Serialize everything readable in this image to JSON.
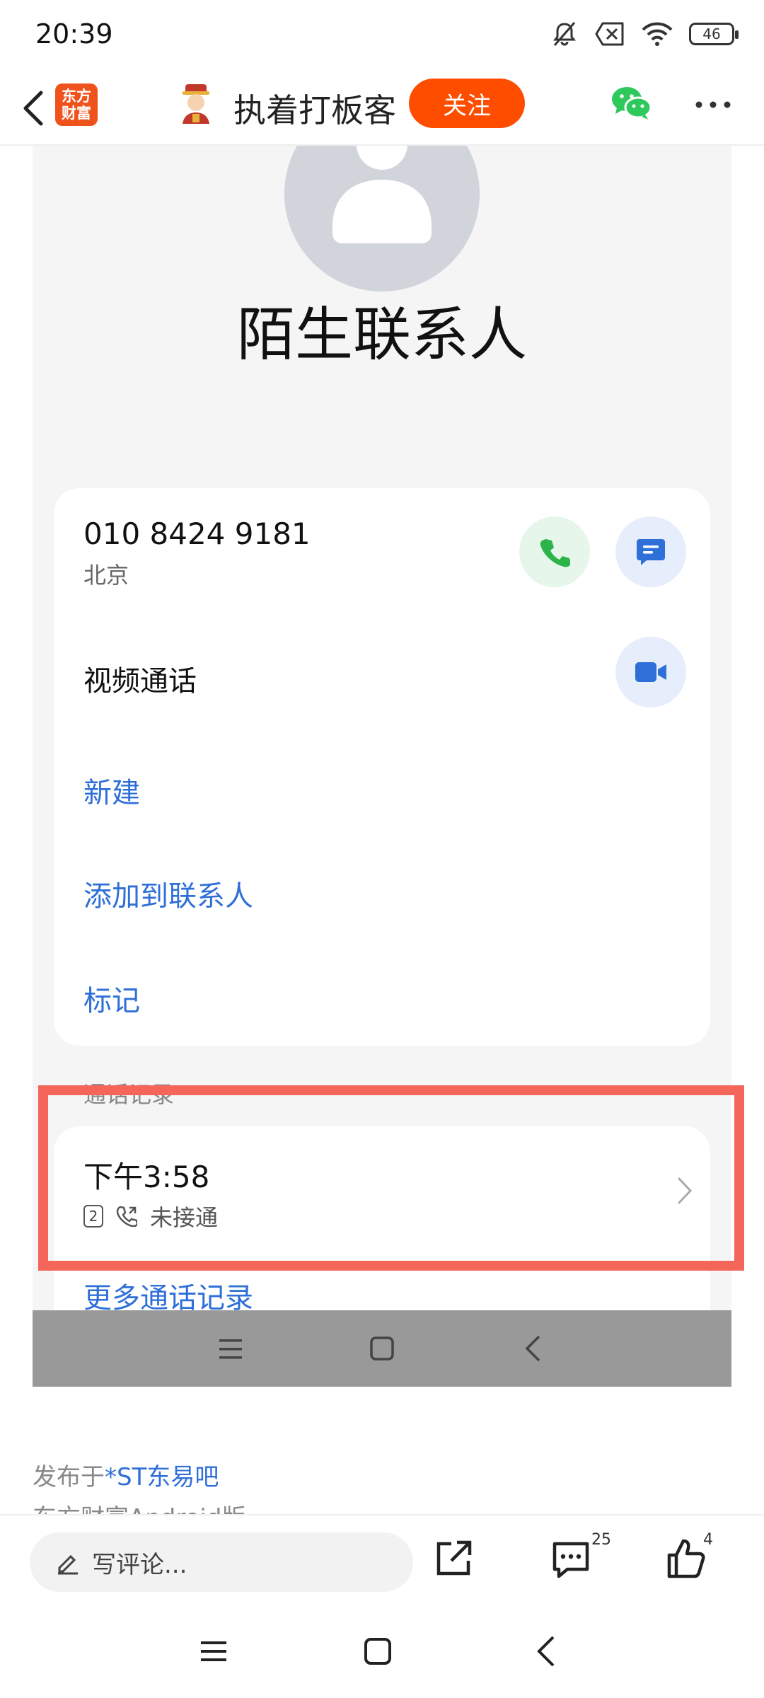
{
  "status_bar": {
    "time": "20:39",
    "battery": "46",
    "icons": [
      "mute-icon",
      "no-sim-icon",
      "wifi-icon",
      "battery-icon"
    ]
  },
  "header": {
    "app_logo_line1": "东方",
    "app_logo_line2": "财富",
    "user_name": "执着打板客",
    "follow_label": "关注",
    "accent": "#ff4d00"
  },
  "contact": {
    "name": "陌生联系人",
    "phone_number": "010 8424 9181",
    "location": "北京",
    "video_call_label": "视频通话",
    "actions": {
      "new": "新建",
      "add_to_contacts": "添加到联系人",
      "mark": "标记"
    }
  },
  "call_log": {
    "title": "通话记录",
    "entry_time": "下午3:58",
    "entry_count": "2",
    "entry_status": "未接通",
    "more_label": "更多通话记录"
  },
  "post": {
    "published_prefix": "发布于",
    "forum": "*ST东易吧",
    "client": "东方财富Android版"
  },
  "action_bar": {
    "comment_placeholder": "写评论...",
    "comments_count": "25",
    "likes_count": "4"
  },
  "colors": {
    "link_blue": "#2f6fd8",
    "highlight": "#f4655a",
    "call_green": "#2cb34a"
  }
}
